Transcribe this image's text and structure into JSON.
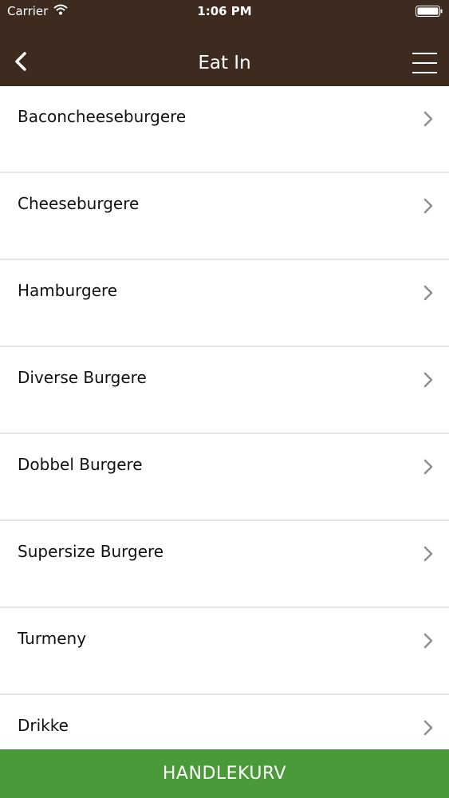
{
  "status_bar": {
    "carrier": "Carrier",
    "time": "1:06 PM"
  },
  "nav": {
    "title": "Eat In"
  },
  "categories": [
    {
      "label": "Baconcheeseburgere"
    },
    {
      "label": "Cheeseburgere"
    },
    {
      "label": "Hamburgere"
    },
    {
      "label": "Diverse Burgere"
    },
    {
      "label": "Dobbel Burgere"
    },
    {
      "label": "Supersize Burgere"
    },
    {
      "label": "Turmeny"
    },
    {
      "label": "Drikke"
    }
  ],
  "cart": {
    "label": "HANDLEKURV"
  },
  "colors": {
    "header": "#3d2b1f",
    "cart": "#4a9a3a",
    "divider": "#e6e6e6",
    "chevron": "#8e8e8e"
  }
}
